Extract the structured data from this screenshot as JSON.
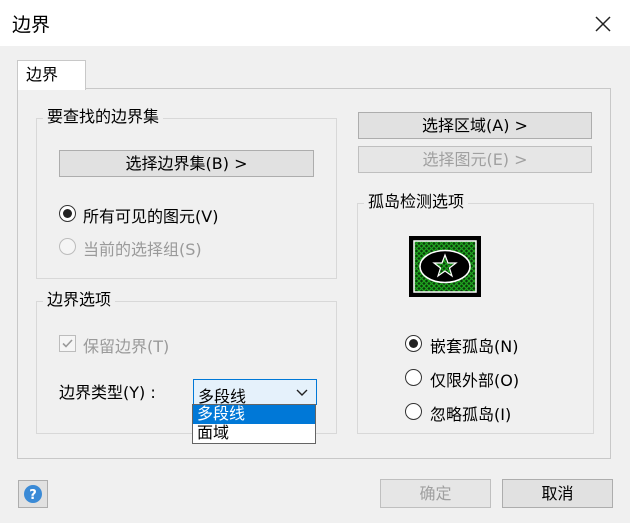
{
  "window": {
    "title": "边界"
  },
  "tabs": [
    {
      "label": "边界"
    }
  ],
  "boundary_set": {
    "group_label": "要查找的边界集",
    "select_button": "选择边界集(B) >",
    "options": [
      {
        "label": "所有可见的图元(V)",
        "checked": true,
        "disabled": false
      },
      {
        "label": "当前的选择组(S)",
        "checked": false,
        "disabled": true
      }
    ]
  },
  "boundary_options": {
    "group_label": "边界选项",
    "retain_label": "保留边界(T)",
    "retain_checked": true,
    "type_label": "边界类型(Y) :",
    "type_value": "多段线",
    "type_options": [
      "多段线",
      "面域"
    ],
    "type_selected_index": 0
  },
  "right_buttons": {
    "select_area": "选择区域(A) >",
    "select_element": "选择图元(E) >"
  },
  "island": {
    "group_label": "孤岛检测选项",
    "options": [
      {
        "label": "嵌套孤岛(N)",
        "checked": true
      },
      {
        "label": "仅限外部(O)",
        "checked": false
      },
      {
        "label": "忽略孤岛(I)",
        "checked": false
      }
    ]
  },
  "footer": {
    "help": "?",
    "ok": "确定",
    "cancel": "取消"
  },
  "colors": {
    "accent": "#0078d7",
    "preview_green": "#1fa51f"
  }
}
